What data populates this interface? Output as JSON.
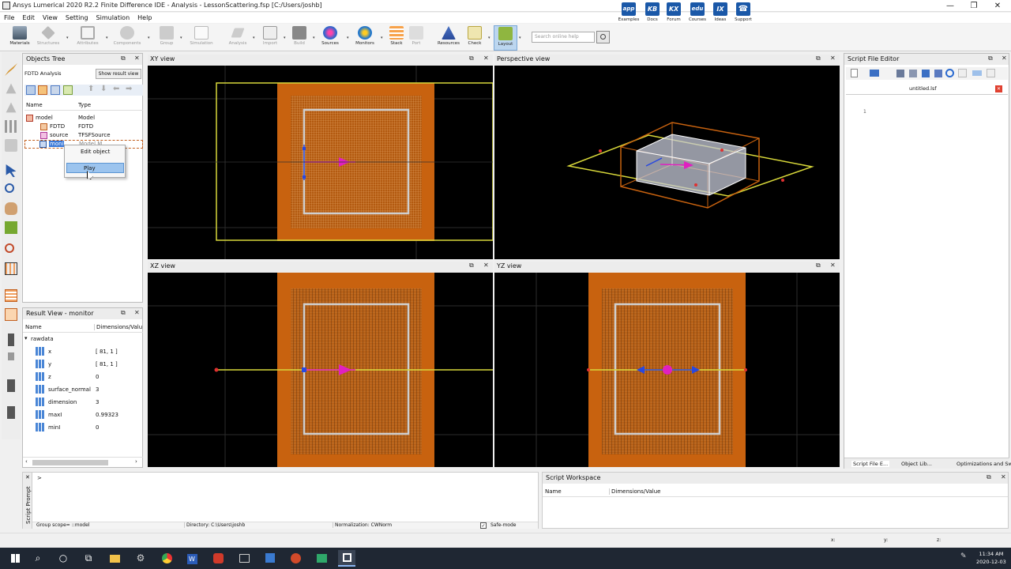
{
  "window": {
    "title": "Ansys Lumerical 2020 R2.2 Finite Difference IDE - Analysis - LessonScattering.fsp [C:/Users/joshb]"
  },
  "menu": [
    "File",
    "Edit",
    "View",
    "Setting",
    "Simulation",
    "Help"
  ],
  "toolbar": [
    {
      "label": "Materials",
      "icon": "materials-icon",
      "enabled": true
    },
    {
      "label": "Structures",
      "icon": "structures-icon",
      "enabled": false
    },
    {
      "label": "Attributes",
      "icon": "attributes-icon",
      "enabled": false
    },
    {
      "label": "Components",
      "icon": "components-icon",
      "enabled": false
    },
    {
      "label": "Group",
      "icon": "group-icon",
      "enabled": false
    },
    {
      "label": "Simulation",
      "icon": "simulation-icon",
      "enabled": false
    },
    {
      "label": "Analysis",
      "icon": "analysis-icon",
      "enabled": false
    },
    {
      "label": "Import",
      "icon": "import-icon",
      "enabled": false
    },
    {
      "label": "Build",
      "icon": "build-icon",
      "enabled": false
    },
    {
      "label": "Sources",
      "icon": "sources-icon",
      "enabled": true
    },
    {
      "label": "Monitors",
      "icon": "monitors-icon",
      "enabled": true
    },
    {
      "label": "Stack",
      "icon": "stack-icon",
      "enabled": true
    },
    {
      "label": "Port",
      "icon": "port-icon",
      "enabled": false
    },
    {
      "label": "Resources",
      "icon": "resources-icon",
      "enabled": true
    },
    {
      "label": "Check",
      "icon": "check-icon",
      "enabled": true
    },
    {
      "label": "Layout",
      "icon": "layout-icon",
      "enabled": true
    }
  ],
  "search": {
    "placeholder": "Search online help"
  },
  "help_links": [
    {
      "label": "Examples",
      "icon_text": "app"
    },
    {
      "label": "Docs",
      "icon_text": "KB"
    },
    {
      "label": "Forum",
      "icon_text": "KX"
    },
    {
      "label": "Courses",
      "icon_text": "edu"
    },
    {
      "label": "Ideas",
      "icon_text": "IX"
    },
    {
      "label": "Support",
      "icon_text": "☎"
    }
  ],
  "objects_tree": {
    "title": "Objects Tree",
    "mode_label": "FDTD Analysis",
    "show_result_button": "Show result view",
    "col_name": "Name",
    "col_type": "Type",
    "rows": [
      {
        "name": "model",
        "type": "Model"
      },
      {
        "name": "FDTD",
        "type": "FDTD"
      },
      {
        "name": "source",
        "type": "TFSFSource"
      },
      {
        "name": "moni",
        "type": "Model M"
      }
    ],
    "context_menu": [
      "Edit object",
      "Play"
    ]
  },
  "result_view": {
    "title": "Result View - monitor",
    "col_name": "Name",
    "col_value": "Dimensions/Valu",
    "group": "rawdata",
    "rows": [
      {
        "name": "x",
        "value": "[ 81, 1 ]"
      },
      {
        "name": "y",
        "value": "[ 81, 1 ]"
      },
      {
        "name": "z",
        "value": "0"
      },
      {
        "name": "surface_normal",
        "value": "3"
      },
      {
        "name": "dimension",
        "value": "3"
      },
      {
        "name": "maxI",
        "value": "0.99323"
      },
      {
        "name": "minI",
        "value": "0"
      }
    ]
  },
  "views": {
    "xy": "XY view",
    "perspective": "Perspective view",
    "xz": "XZ view",
    "yz": "YZ view"
  },
  "script_editor": {
    "title": "Script File Editor",
    "file_tab": "untitled.lsf",
    "line": "1",
    "bottom_tabs": [
      "Script File E...",
      "Object Lib...",
      "Optimizations and Sw..."
    ]
  },
  "script_prompt": {
    "label": "Script Prompt",
    "prompt": ">"
  },
  "status": {
    "group_scope": "Group scope= ::model",
    "directory": "Directory: C:\\Users\\joshb",
    "normalization": "Normalization: CWNorm",
    "safe_mode": "Safe-mode",
    "coords": [
      "x:",
      "y:",
      "z:"
    ]
  },
  "workspace": {
    "title": "Script Workspace",
    "col_name": "Name",
    "col_value": "Dimensions/Value"
  },
  "taskbar": {
    "time": "11:34 AM",
    "date": "2020-12-03"
  },
  "colors": {
    "orange": "#c8620f",
    "grid": "#e0a060",
    "yellow": "#d8d83a",
    "magenta": "#e020c0",
    "blue": "#2848e0"
  }
}
